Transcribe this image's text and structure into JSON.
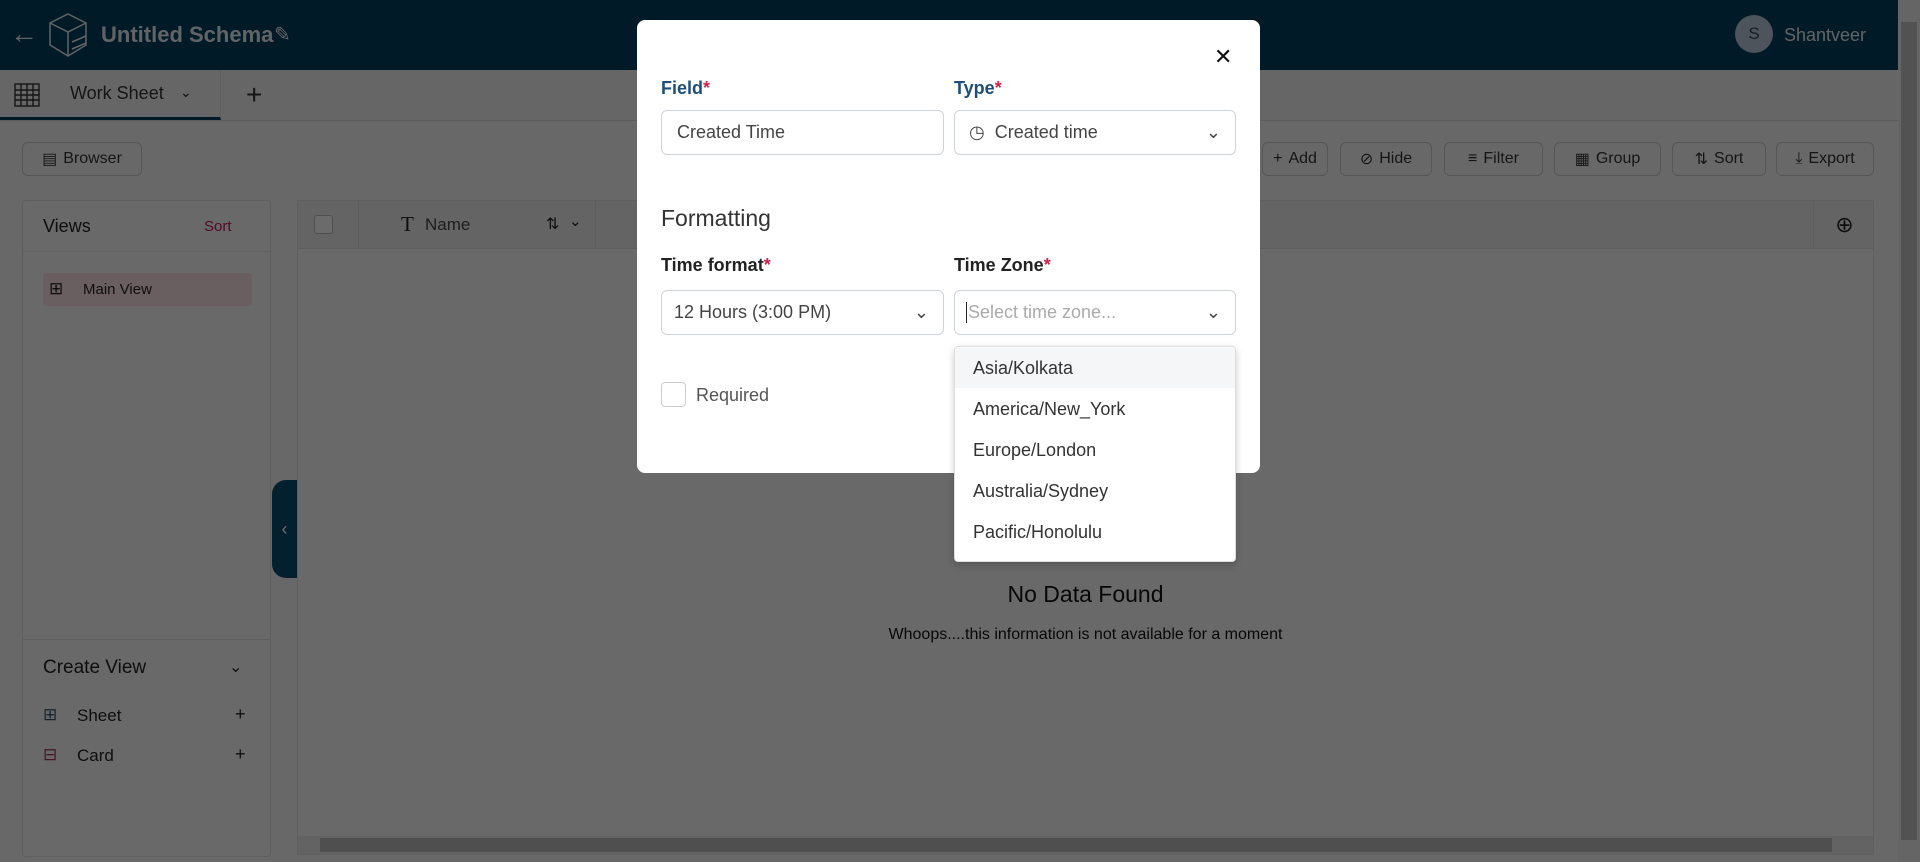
{
  "header": {
    "title": "Untitled Schema",
    "user_initial": "S",
    "user_name": "Shantveer"
  },
  "tabs": [
    {
      "label": "Work Sheet"
    }
  ],
  "toolbar": {
    "browser": "Browser",
    "add": "Add",
    "hide": "Hide",
    "filter": "Filter",
    "group": "Group",
    "sort": "Sort",
    "export": "Export"
  },
  "views": {
    "title": "Views",
    "sort": "Sort",
    "items": [
      {
        "label": "Main View"
      }
    ]
  },
  "create_view": {
    "title": "Create View",
    "items": [
      {
        "label": "Sheet"
      },
      {
        "label": "Card"
      }
    ]
  },
  "grid": {
    "columns": [
      {
        "label": "Name"
      }
    ],
    "empty_title": "No Data Found",
    "empty_subtitle": "Whoops....this information is not available for a moment"
  },
  "modal": {
    "field_label": "Field",
    "field_value": "Created Time",
    "type_label": "Type",
    "type_value": "Created time",
    "formatting": "Formatting",
    "time_format_label": "Time format",
    "time_format_value": "12 Hours (3:00 PM)",
    "time_zone_label": "Time Zone",
    "time_zone_placeholder": "Select time zone...",
    "required_label": "Required",
    "required_checked": false,
    "req_mark": "*",
    "time_zone_options": [
      "Asia/Kolkata",
      "America/New_York",
      "Europe/London",
      "Australia/Sydney",
      "Pacific/Honolulu"
    ]
  },
  "colors": {
    "header": "#003d5e",
    "required": "#d0234c",
    "sort_link": "#c2185b"
  }
}
